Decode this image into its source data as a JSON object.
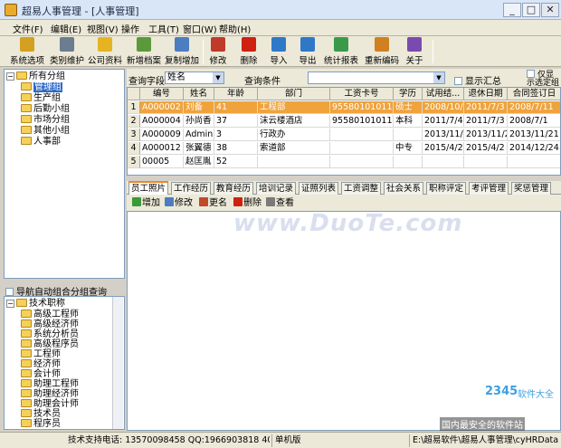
{
  "window": {
    "title": "超易人事管理 - [人事管理]",
    "min": "_",
    "max": "□",
    "close": "✕"
  },
  "menu": [
    "文件(F)",
    "编辑(E)",
    "视图(V)",
    "操作",
    "工具(T)",
    "窗口(W)",
    "帮助(H)"
  ],
  "toolbar": [
    {
      "label": "系统选项",
      "color": "#d4a020"
    },
    {
      "label": "类别维护",
      "color": "#6b7d8f"
    },
    {
      "label": "公司资料",
      "color": "#e6b422"
    },
    {
      "label": "新增档案",
      "color": "#5a9a3a"
    },
    {
      "label": "复制增加",
      "color": "#4c7dc0"
    },
    {
      "label": "修改",
      "color": "#c03a2a"
    },
    {
      "label": "删除",
      "color": "#d02010"
    },
    {
      "label": "导入",
      "color": "#2f78c8"
    },
    {
      "label": "导出",
      "color": "#2f78c8"
    },
    {
      "label": "统计报表",
      "color": "#3a9a4a"
    },
    {
      "label": "重新编码",
      "color": "#d08020"
    },
    {
      "label": "关于",
      "color": "#7a4ab0"
    }
  ],
  "tree_top": {
    "root": "所有分组",
    "items": [
      "管理组",
      "生产组",
      "后勤小组",
      "市场分组",
      "其他小组",
      "人事部"
    ],
    "selected": "管理组"
  },
  "nav_check_label": "导航自动组合分组查询",
  "tree_bottom": {
    "root": "技术职称",
    "items": [
      "高级工程师",
      "高级经济师",
      "系统分析员",
      "高级程序员",
      "工程师",
      "经济师",
      "会计师",
      "助理工程师",
      "助理经济师",
      "助理会计师",
      "技术员",
      "程序员"
    ]
  },
  "query": {
    "field_label": "查询字段",
    "field_value": "姓名",
    "cond_label": "查询条件",
    "cond_value": "",
    "summary_label": "显示汇总",
    "only_label": "仅显示选定组"
  },
  "grid": {
    "headers": [
      "",
      "编号",
      "姓名",
      "年龄",
      "部门",
      "工资卡号",
      "学历",
      "试用结...",
      "退休日期",
      "合同签订日"
    ],
    "rows": [
      [
        "1",
        "A000002",
        "刘备",
        "41",
        "工程部",
        "955801010111",
        "硕士",
        "2008/10/10",
        "2011/7/3",
        "2008/7/11"
      ],
      [
        "2",
        "A000004",
        "孙尚香",
        "37",
        "沫云楼酒店",
        "955801010111",
        "本科",
        "2011/7/4",
        "2011/7/3",
        "2008/7/1"
      ],
      [
        "3",
        "A000009",
        "Admin",
        "3",
        "行政办",
        "",
        "",
        "2013/11/21",
        "2013/11/21",
        "2013/11/21"
      ],
      [
        "4",
        "A000012",
        "张翼德",
        "38",
        "索道部",
        "",
        "中专",
        "2015/4/2",
        "2015/4/2",
        "2014/12/24"
      ],
      [
        "5",
        "00005",
        "赵匡胤",
        "52",
        "",
        "",
        "",
        "",
        "",
        ""
      ]
    ]
  },
  "tabs": [
    "员工照片",
    "工作经历",
    "教育经历",
    "培训记录",
    "证照列表",
    "工资调整",
    "社会关系",
    "职称评定",
    "考评管理",
    "奖惩管理"
  ],
  "active_tab": "员工照片",
  "subtoolbar": [
    {
      "label": "增加",
      "color": "#3a9a3a"
    },
    {
      "label": "修改",
      "color": "#4c7dc0"
    },
    {
      "label": "更名",
      "color": "#c04a2a"
    },
    {
      "label": "删除",
      "color": "#d02010"
    },
    {
      "label": "查看",
      "color": "#7a7a7a"
    }
  ],
  "watermark": "www.DuoTe.com",
  "logo_2345": "2345",
  "logo_2345_sub": "软件大全",
  "watermark_footer": "国内最安全的软件站",
  "status": {
    "support": "技术支持电话: 13570098458 QQ:1966903818 408088750",
    "mode": "单机版",
    "path": "E:\\超易软件\\超易人事管理\\cyHRData.sj"
  }
}
